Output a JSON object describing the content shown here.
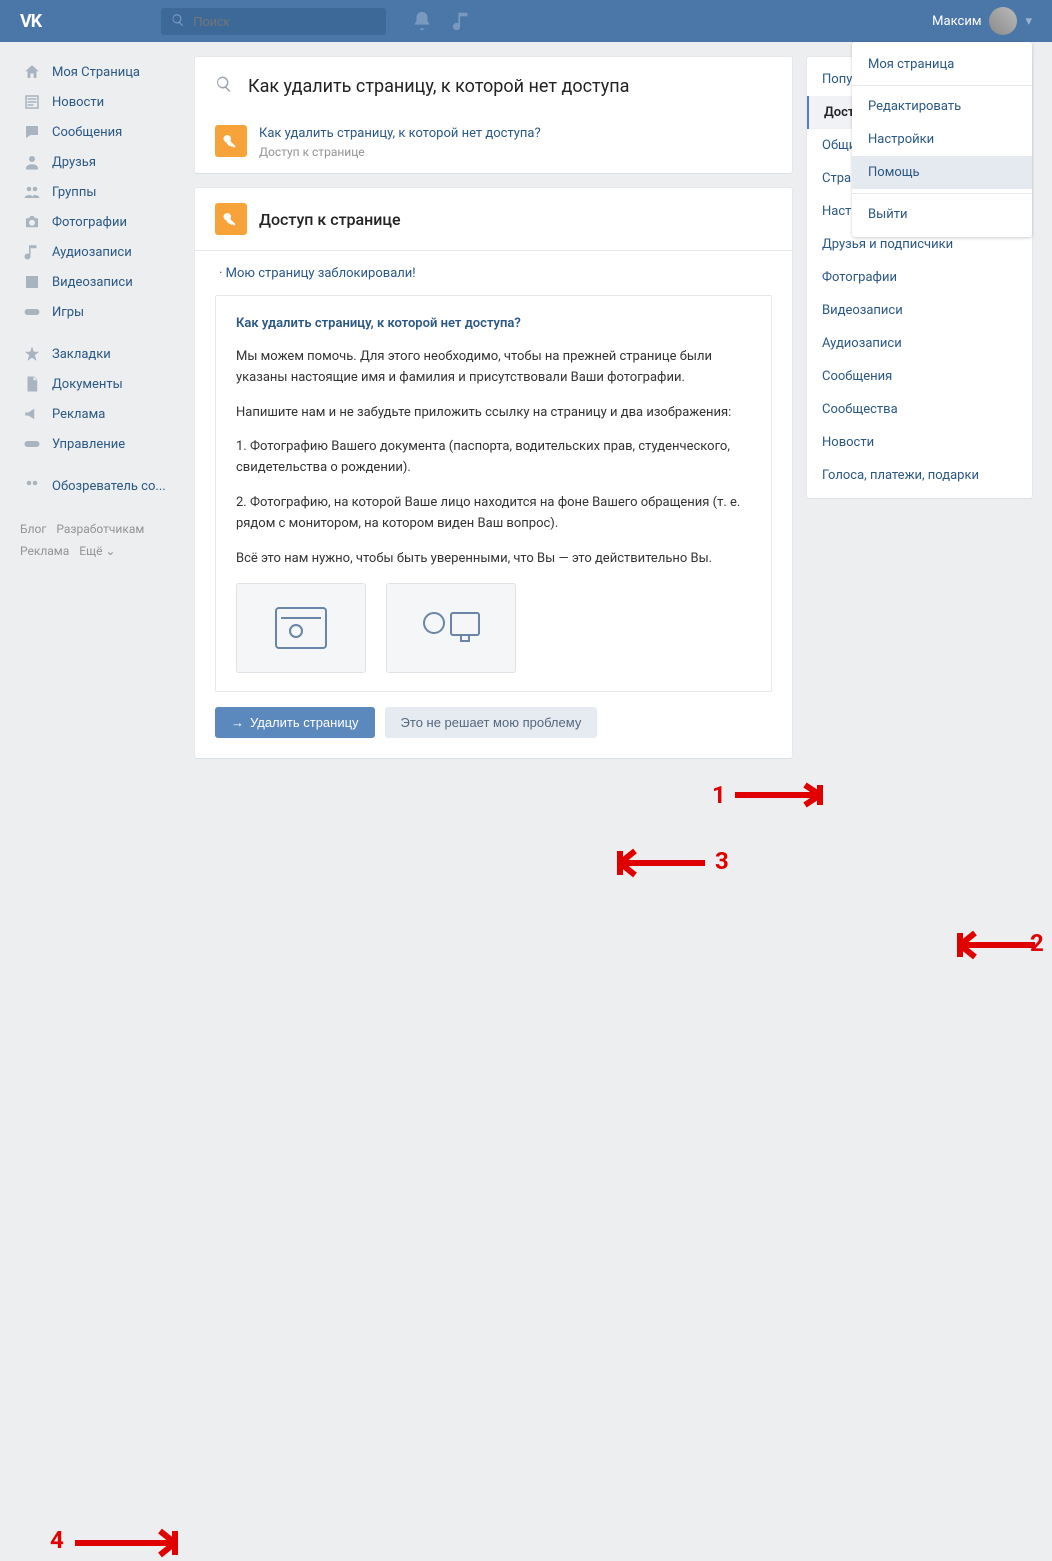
{
  "header": {
    "logo": "VK",
    "search_placeholder": "Поиск",
    "username": "Максим"
  },
  "left_nav": [
    "Моя Страница",
    "Новости",
    "Сообщения",
    "Друзья",
    "Группы",
    "Фотографии",
    "Аудиозаписи",
    "Видеозаписи",
    "Игры"
  ],
  "left_nav2": [
    "Закладки",
    "Документы",
    "Реклама",
    "Управление"
  ],
  "left_nav3": [
    "Обозреватель со..."
  ],
  "footer": {
    "blog": "Блог",
    "dev": "Разработчикам",
    "ads": "Реклама",
    "more": "Ещё ⌄"
  },
  "search_card": {
    "query": "Как удалить страницу, к которой нет доступа"
  },
  "result": {
    "title": "Как удалить страницу, к которой нет доступа?",
    "sub": "Доступ к странице"
  },
  "section": {
    "title": "Доступ к странице",
    "blocked_link": "Мою страницу заблокировали!"
  },
  "article": {
    "heading": "Как удалить страницу, к которой нет доступа?",
    "p1": "Мы можем помочь. Для этого необходимо, чтобы на прежней странице были указаны настоящие имя и фамилия и присутствовали Ваши фотографии.",
    "p2": "Напишите нам и не забудьте приложить ссылку на страницу и два изображения:",
    "p3": "1. Фотографию Вашего документа (паспорта, водительских прав, студенческого, свидетельства о рождении).",
    "p4": "2. Фотографию, на которой Ваше лицо находится на фоне Вашего обращения (т. е. рядом с монитором, на котором виден Ваш вопрос).",
    "p5": "Всё это нам нужно, чтобы быть уверенными, что Вы — это действительно Вы."
  },
  "actions": {
    "delete": "Удалить страницу",
    "not_solved": "Это не решает мою проблему"
  },
  "sidebar": [
    "Популярные",
    "Доступ к странице",
    "Общие вопросы",
    "Страница",
    "Настройки приватности",
    "Друзья и подписчики",
    "Фотографии",
    "Видеозаписи",
    "Аудиозаписи",
    "Сообщения",
    "Сообщества",
    "Новости",
    "Голоса, платежи, подарки"
  ],
  "dropdown": [
    "Моя страница",
    "Редактировать",
    "Настройки",
    "Помощь",
    "Выйти"
  ],
  "anno": {
    "n1": "1",
    "n2": "2",
    "n3": "3",
    "n4": "4"
  }
}
